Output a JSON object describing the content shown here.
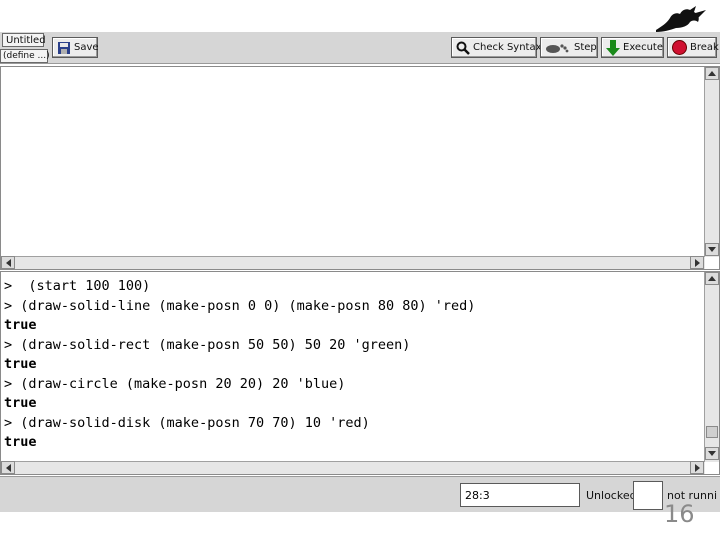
{
  "toolbar": {
    "file_name": "Untitled",
    "define_menu": "(define ...)",
    "save_label": "Save",
    "check_syntax_label": "Check Syntax",
    "step_label": "Step",
    "execute_label": "Execute",
    "break_label": "Break"
  },
  "repl": {
    "lines": [
      {
        "text": ">  (start 100 100)",
        "kind": "input"
      },
      {
        "text": "> (draw-solid-line (make-posn 0 0) (make-posn 80 80) 'red)",
        "kind": "input"
      },
      {
        "text": "true",
        "kind": "result"
      },
      {
        "text": "> (draw-solid-rect (make-posn 50 50) 50 20 'green)",
        "kind": "input"
      },
      {
        "text": "true",
        "kind": "result"
      },
      {
        "text": "> (draw-circle (make-posn 20 20) 20 'blue)",
        "kind": "input"
      },
      {
        "text": "true",
        "kind": "result"
      },
      {
        "text": "> (draw-solid-disk (make-posn 70 70) 10 'red)",
        "kind": "input"
      },
      {
        "text": "true",
        "kind": "result"
      }
    ]
  },
  "status": {
    "position": "28:3",
    "lock_state": "Unlocked",
    "run_state": "not running"
  },
  "slide": {
    "page_number": "16"
  },
  "colors": {
    "execute_arrow": "#1a8a1a",
    "break_stop": "#d01030"
  }
}
